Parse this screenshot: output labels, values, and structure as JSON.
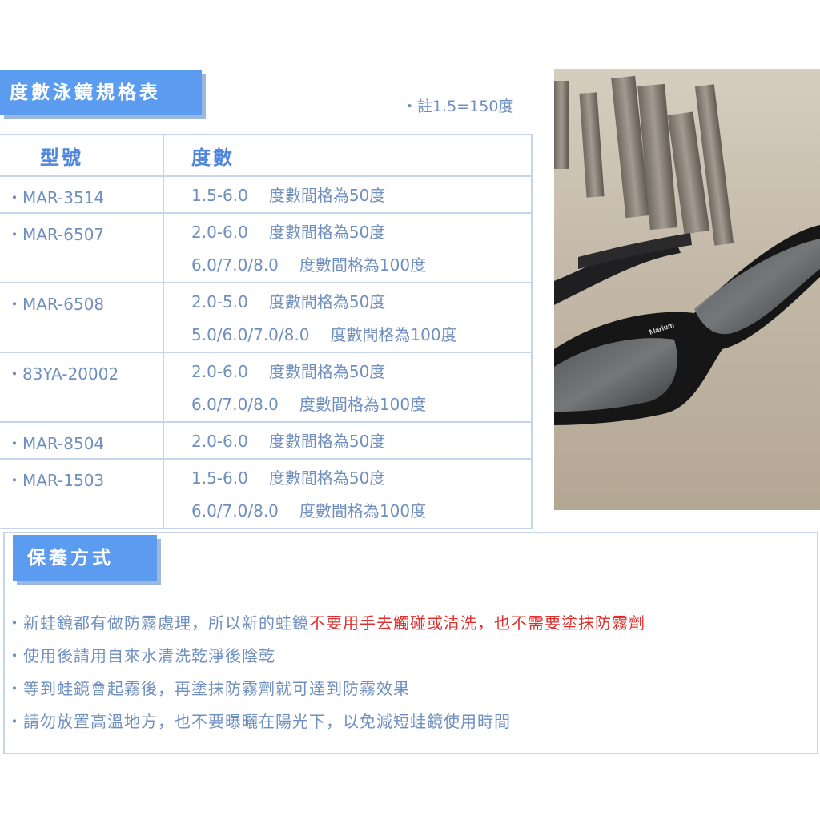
{
  "spec_section": {
    "title": "度數泳鏡規格表",
    "note": "・註1.5=150度",
    "headers": [
      "型號",
      "度數"
    ],
    "rows": [
      {
        "model": "・MAR-3514",
        "lines": [
          [
            "1.5-6.0",
            "度數間格為50度"
          ]
        ]
      },
      {
        "model": "・MAR-6507",
        "lines": [
          [
            "2.0-6.0",
            "度數間格為50度"
          ],
          [
            "6.0/7.0/8.0",
            "度數間格為100度"
          ]
        ]
      },
      {
        "model": "・MAR-6508",
        "lines": [
          [
            "2.0-5.0",
            "度數間格為50度"
          ],
          [
            "5.0/6.0/7.0/8.0",
            "度數間格為100度"
          ]
        ]
      },
      {
        "model": "・83YA-20002",
        "lines": [
          [
            "2.0-6.0",
            "度數間格為50度"
          ],
          [
            "6.0/7.0/8.0",
            "度數間格為100度"
          ]
        ]
      },
      {
        "model": "・MAR-8504",
        "lines": [
          [
            "2.0-6.0",
            "度數間格為50度"
          ]
        ]
      },
      {
        "model": "・MAR-1503",
        "lines": [
          [
            "1.5-6.0",
            "度數間格為50度"
          ],
          [
            "6.0/7.0/8.0",
            "度數間格為100度"
          ]
        ]
      }
    ]
  },
  "photo": {
    "brand": "Marium"
  },
  "care_section": {
    "title": "保養方式",
    "item1_a": "・新蛙鏡都有做防霧處理，所以新的蛙鏡",
    "item1_b": "不要用手去觸碰或清洗，也不需要塗抹防霧劑",
    "item2": "・使用後請用自來水清洗乾淨後陰乾",
    "item3": "・等到蛙鏡會起霧後，再塗抹防霧劑就可達到防霧效果",
    "item4": "・請勿放置高溫地方，也不要曝曬在陽光下，以免減短蛙鏡使用時間"
  },
  "colors": {
    "banner": "#5b9cf0",
    "text": "#6f8fbf",
    "highlight": "#e0302e",
    "border": "#c6d5ec"
  }
}
